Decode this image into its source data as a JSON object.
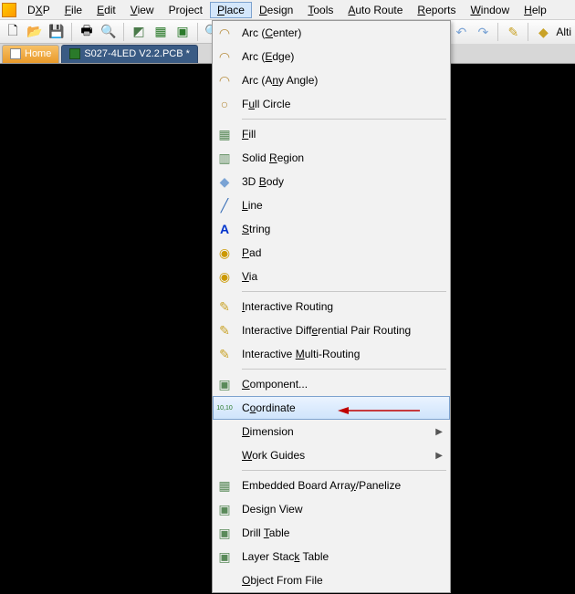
{
  "menubar": {
    "items": [
      {
        "pre": "D",
        "u": "X",
        "post": "P"
      },
      {
        "pre": "",
        "u": "F",
        "post": "ile"
      },
      {
        "pre": "",
        "u": "E",
        "post": "dit"
      },
      {
        "pre": "",
        "u": "V",
        "post": "iew"
      },
      {
        "pre": "Pro",
        "u": "j",
        "post": "ect"
      },
      {
        "pre": "",
        "u": "P",
        "post": "lace"
      },
      {
        "pre": "",
        "u": "D",
        "post": "esign"
      },
      {
        "pre": "",
        "u": "T",
        "post": "ools"
      },
      {
        "pre": "",
        "u": "A",
        "post": "uto Route"
      },
      {
        "pre": "",
        "u": "R",
        "post": "eports"
      },
      {
        "pre": "",
        "u": "W",
        "post": "indow"
      },
      {
        "pre": "",
        "u": "H",
        "post": "elp"
      }
    ]
  },
  "toolbar_right_text": "Alti",
  "tabs": {
    "home": "Home",
    "active": "S027-4LED V2.2.PCB *"
  },
  "dropdown": {
    "items": [
      {
        "icon": "◠",
        "pre": "Arc (",
        "u": "C",
        "post": "enter)"
      },
      {
        "icon": "◠",
        "pre": "Arc (",
        "u": "E",
        "post": "dge)"
      },
      {
        "icon": "◠",
        "pre": "Arc (A",
        "u": "n",
        "post": "y Angle)"
      },
      {
        "icon": "○",
        "pre": "F",
        "u": "u",
        "post": "ll Circle"
      },
      {
        "sep": true
      },
      {
        "icon": "▦",
        "pre": "",
        "u": "F",
        "post": "ill"
      },
      {
        "icon": "▥",
        "pre": "Solid ",
        "u": "R",
        "post": "egion"
      },
      {
        "icon": "◆",
        "pre": "3D ",
        "u": "B",
        "post": "ody"
      },
      {
        "icon": "╱",
        "pre": "",
        "u": "L",
        "post": "ine"
      },
      {
        "icon": "A",
        "pre": "",
        "u": "S",
        "post": "tring",
        "iconColor": "#0033cc",
        "iconBold": true
      },
      {
        "icon": "◉",
        "pre": "",
        "u": "P",
        "post": "ad",
        "iconColor": "#cc9900"
      },
      {
        "icon": "◉",
        "pre": "",
        "u": "V",
        "post": "ia",
        "iconColor": "#cc9900"
      },
      {
        "sep": true
      },
      {
        "icon": "✎",
        "pre": "",
        "u": "I",
        "post": "nteractive Routing"
      },
      {
        "icon": "✎",
        "pre": "Interactive Diff",
        "u": "e",
        "post": "rential Pair Routing"
      },
      {
        "icon": "✎",
        "pre": "Interactive ",
        "u": "M",
        "post": "ulti-Routing"
      },
      {
        "sep": true
      },
      {
        "icon": "▣",
        "pre": "",
        "u": "C",
        "post": "omponent..."
      },
      {
        "icon": "⁺",
        "pre": "C",
        "u": "o",
        "post": "ordinate",
        "highlight": true,
        "iconText": "10,10"
      },
      {
        "icon": "",
        "pre": "",
        "u": "D",
        "post": "imension",
        "submenu": true
      },
      {
        "icon": "",
        "pre": "",
        "u": "W",
        "post": "ork Guides",
        "submenu": true
      },
      {
        "sep": true
      },
      {
        "icon": "▦",
        "pre": "Embedded Board Arra",
        "u": "y",
        "post": "/Panelize"
      },
      {
        "icon": "▣",
        "pre": "Desi",
        "u": "g",
        "post": "n View"
      },
      {
        "icon": "▣",
        "pre": "Drill ",
        "u": "T",
        "post": "able"
      },
      {
        "icon": "▣",
        "pre": "Layer Stac",
        "u": "k",
        "post": " Table"
      },
      {
        "icon": "",
        "pre": "",
        "u": "O",
        "post": "bject From File"
      }
    ]
  }
}
